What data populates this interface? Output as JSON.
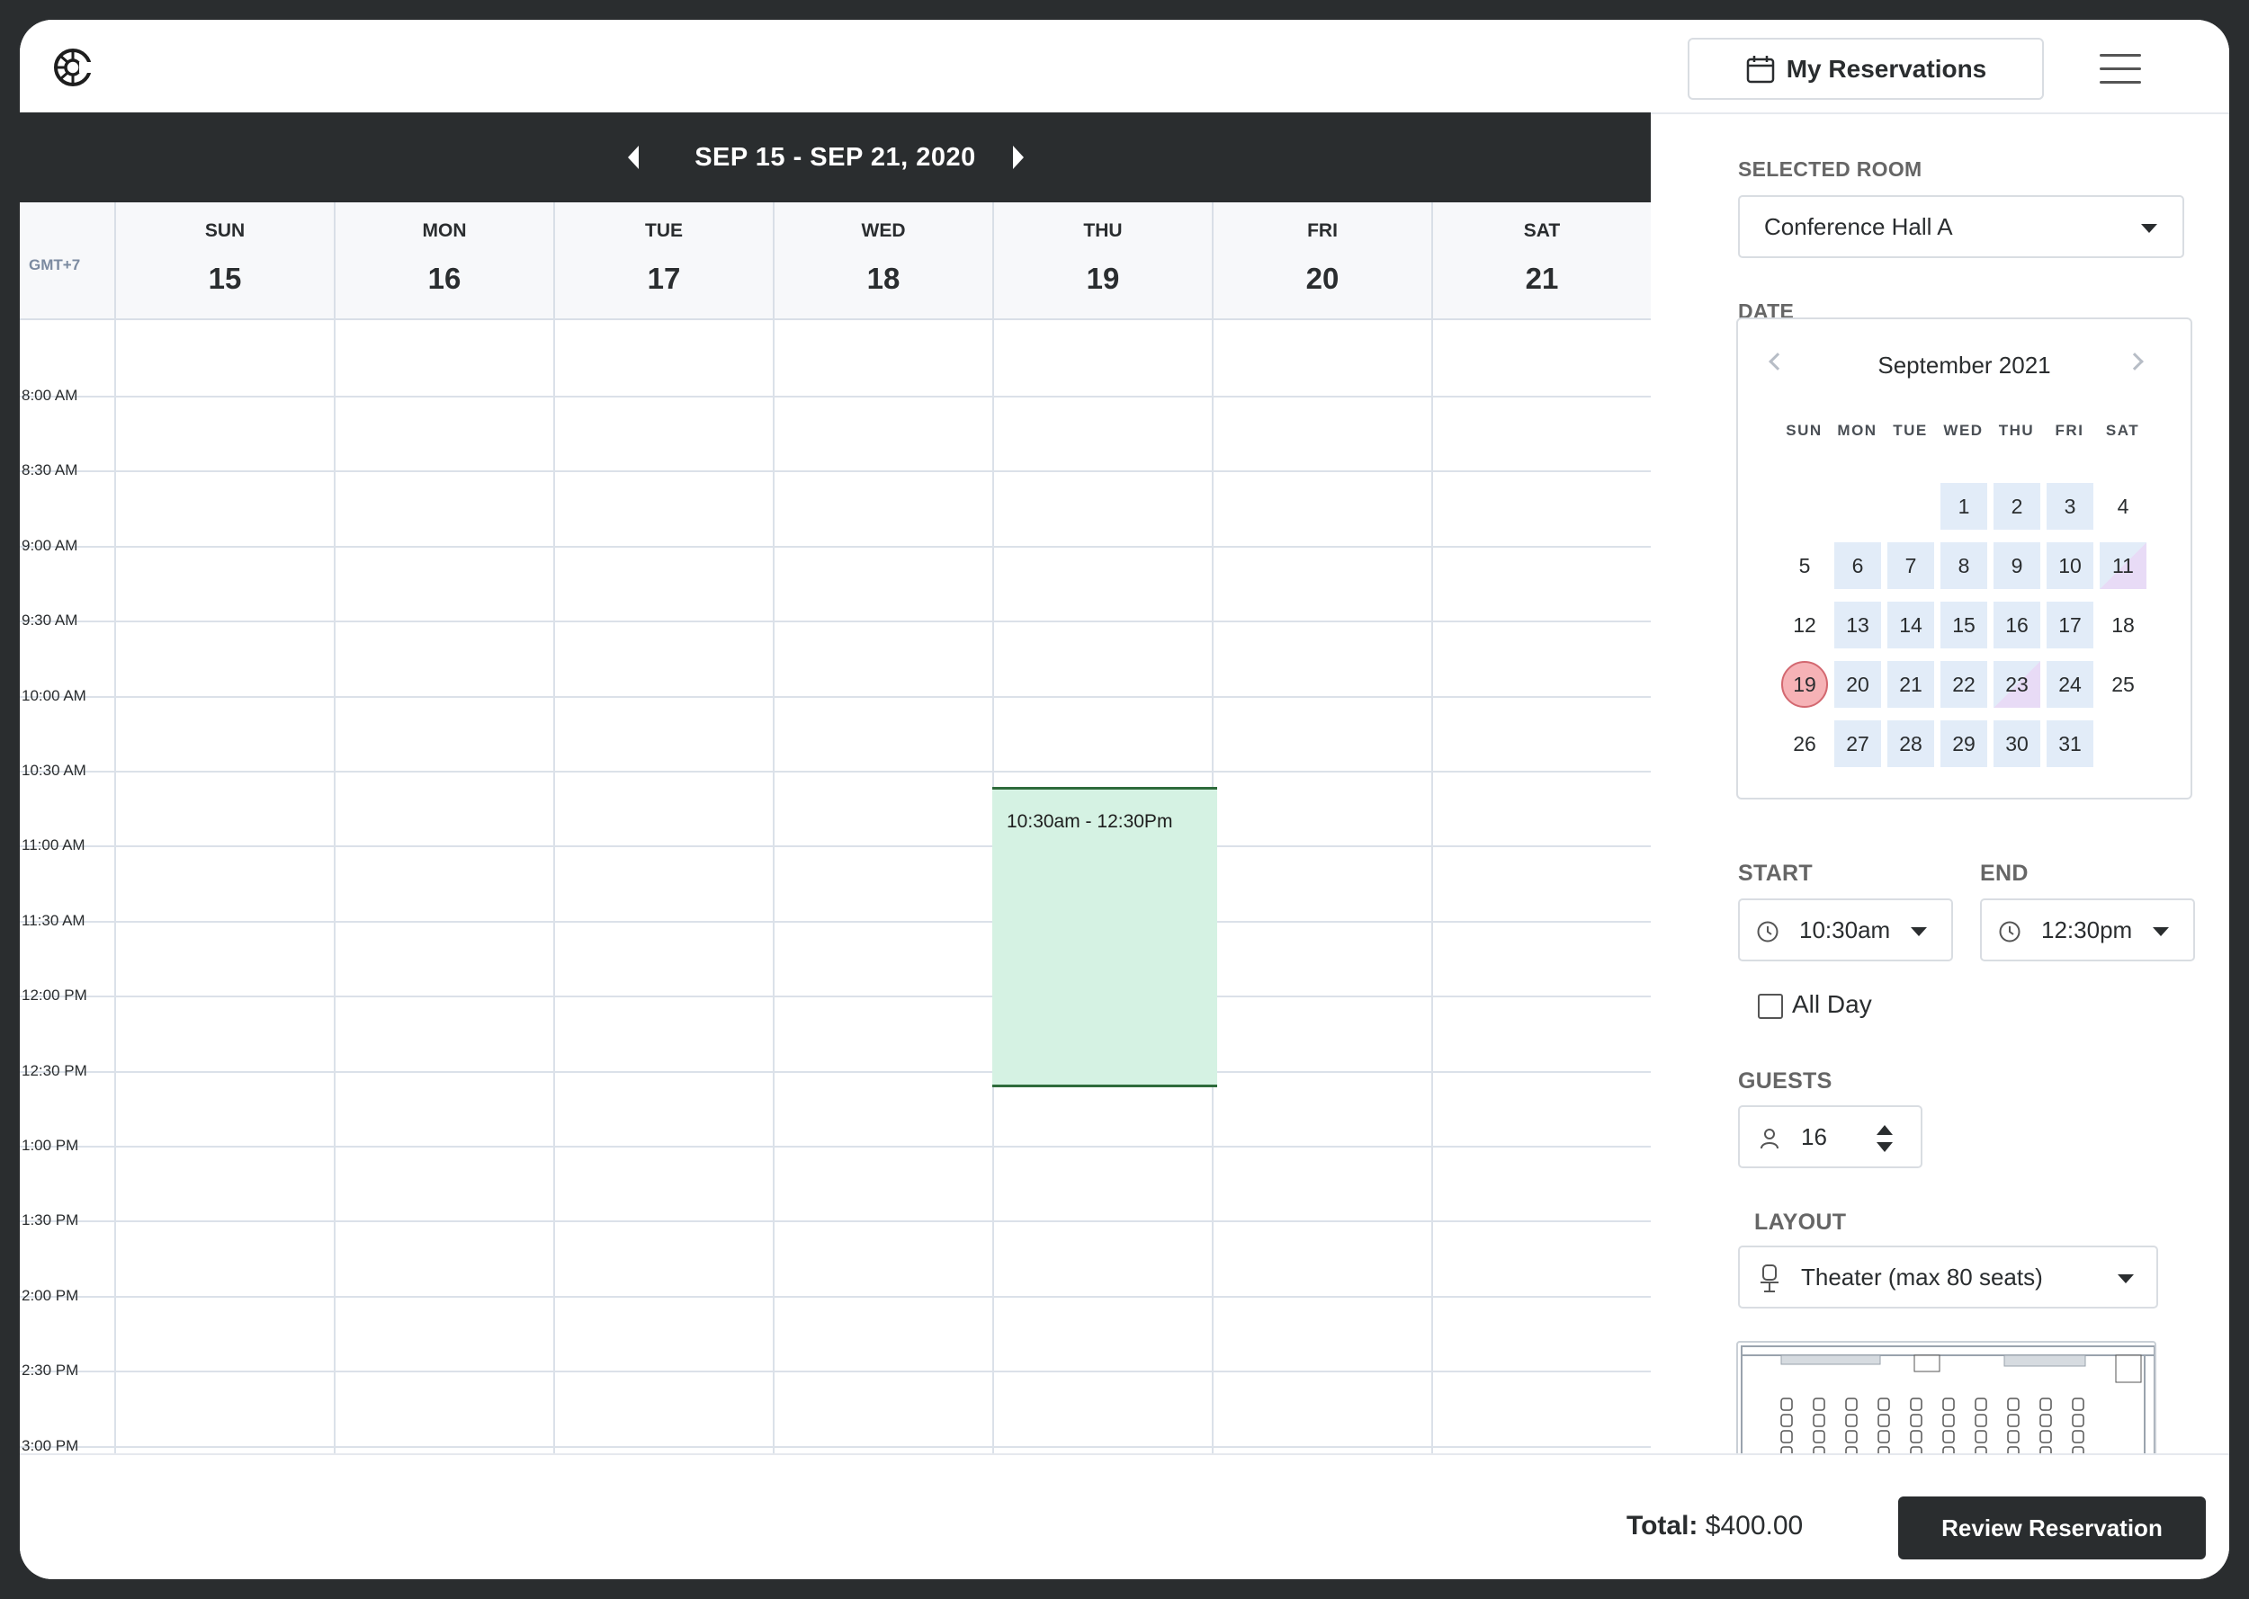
{
  "header": {
    "my_reservations_label": "My Reservations"
  },
  "week": {
    "range": "SEP 15 - SEP 21, 2020",
    "timezone": "GMT+7",
    "days": [
      {
        "name": "SUN",
        "date": "15"
      },
      {
        "name": "MON",
        "date": "16"
      },
      {
        "name": "TUE",
        "date": "17"
      },
      {
        "name": "WED",
        "date": "18"
      },
      {
        "name": "THU",
        "date": "19"
      },
      {
        "name": "FRI",
        "date": "20"
      },
      {
        "name": "SAT",
        "date": "21"
      }
    ],
    "times": [
      "8:00 AM",
      "8:30 AM",
      "9:00 AM",
      "9:30 AM",
      "10:00 AM",
      "10:30 AM",
      "11:00 AM",
      "11:30 AM",
      "12:00 PM",
      "12:30 PM",
      "1:00 PM",
      "1:30 PM",
      "2:00 PM",
      "2:30 PM",
      "3:00 PM"
    ],
    "event": {
      "label": "10:30am - 12:30Pm"
    }
  },
  "sidebar": {
    "selected_room_label": "SELECTED ROOM",
    "selected_room_value": "Conference Hall A",
    "date_label": "DATE",
    "calendar": {
      "month": "September 2021",
      "weekdays": [
        "SUN",
        "MON",
        "TUE",
        "WED",
        "THU",
        "FRI",
        "SAT"
      ],
      "days": [
        "1",
        "2",
        "3",
        "4",
        "5",
        "6",
        "7",
        "8",
        "9",
        "10",
        "11",
        "12",
        "13",
        "14",
        "15",
        "16",
        "17",
        "18",
        "19",
        "20",
        "21",
        "22",
        "23",
        "24",
        "25",
        "26",
        "27",
        "28",
        "29",
        "30",
        "31"
      ],
      "selected_day": "19"
    },
    "start_label": "START",
    "start_value": "10:30am",
    "end_label": "END",
    "end_value": "12:30pm",
    "all_day_label": "All Day",
    "guests_label": "GUESTS",
    "guests_value": "16",
    "layout_label": "LAYOUT",
    "layout_value": "Theater (max 80 seats)"
  },
  "footer": {
    "total_label": "Total:",
    "total_value": "$400.00",
    "review_label": "Review Reservation"
  },
  "colors": {
    "dark": "#2a2d2f",
    "event_fill": "#d5f2e3",
    "event_border": "#2e6b3b",
    "available_day": "#e2ecf8",
    "selected_day": "#f6b2b6"
  }
}
